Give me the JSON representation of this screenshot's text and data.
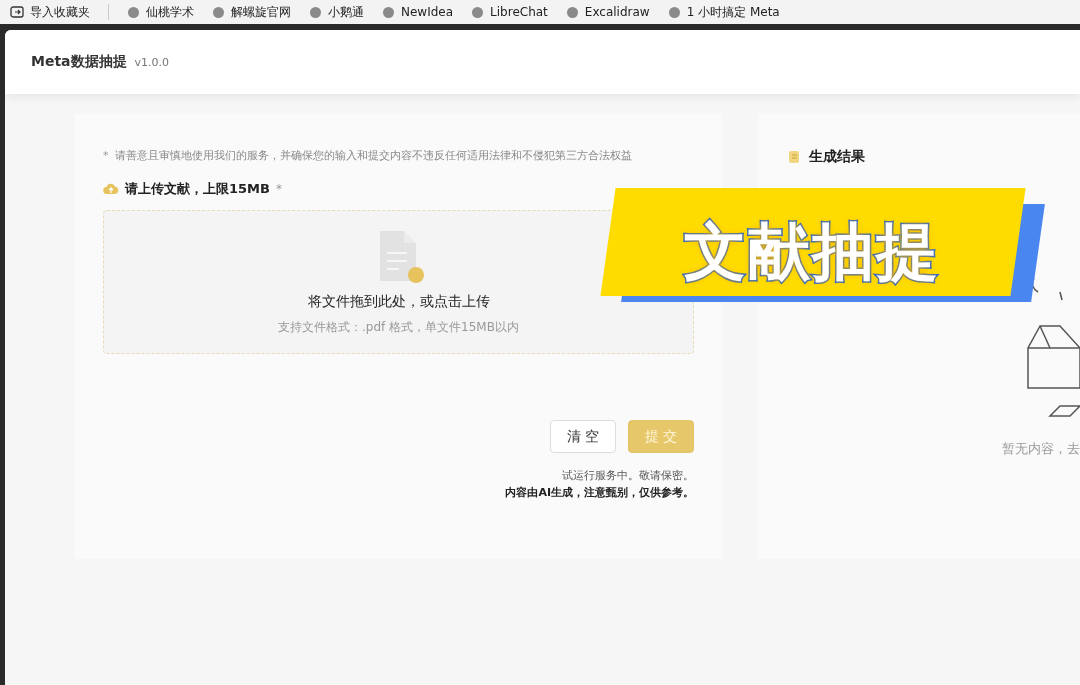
{
  "bookmarks": [
    {
      "label": "导入收藏夹",
      "kind": "import"
    },
    {
      "label": "仙桃学术",
      "kind": "site"
    },
    {
      "label": "解螺旋官网",
      "kind": "site"
    },
    {
      "label": "小鹅通",
      "kind": "site"
    },
    {
      "label": "NewIdea",
      "kind": "site"
    },
    {
      "label": "LibreChat",
      "kind": "site"
    },
    {
      "label": "Excalidraw",
      "kind": "site"
    },
    {
      "label": "1 小时搞定 Meta",
      "kind": "site"
    }
  ],
  "header": {
    "title": "Meta数据抽提",
    "version": "v1.0.0"
  },
  "form": {
    "notice": "请善意且审慎地使用我们的服务，并确保您的输入和提交内容不违反任何适用法律和不侵犯第三方合法权益",
    "upload_label": "请上传文献，上限15MB",
    "required_mark": "*",
    "drop_title": "将文件拖到此处，或点击上传",
    "drop_hint": "支持文件格式：.pdf 格式，单文件15MB以内",
    "buttons": [
      {
        "label": "清 空",
        "kind": "secondary"
      },
      {
        "label": "提 交",
        "kind": "primary",
        "disabled": true
      }
    ],
    "footer": [
      "试运行服务中。敬请保密。",
      "内容由AI生成，注意甄别，仅供参考。"
    ]
  },
  "result": {
    "title": "生成结果",
    "empty_text": "暂无内容，去"
  },
  "overlay": {
    "caption": "文献抽提"
  }
}
